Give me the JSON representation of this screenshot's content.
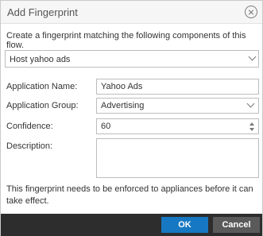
{
  "dialog": {
    "title": "Add Fingerprint",
    "intro": "Create a fingerprint matching the following components of this flow."
  },
  "flow_select": {
    "value": "Host yahoo ads"
  },
  "fields": {
    "app_name": {
      "label": "Application Name:",
      "value": "Yahoo Ads"
    },
    "app_group": {
      "label": "Application Group:",
      "value": "Advertising"
    },
    "confidence": {
      "label": "Confidence:",
      "value": "60"
    },
    "description": {
      "label": "Description:",
      "value": ""
    }
  },
  "note": "This fingerprint needs to be enforced to appliances before it can take effect.",
  "footer": {
    "ok_label": "OK",
    "cancel_label": "Cancel"
  },
  "colors": {
    "ok": "#1678c2",
    "cancel": "#5a5a5a",
    "footer_bg": "#2d2d2d"
  }
}
